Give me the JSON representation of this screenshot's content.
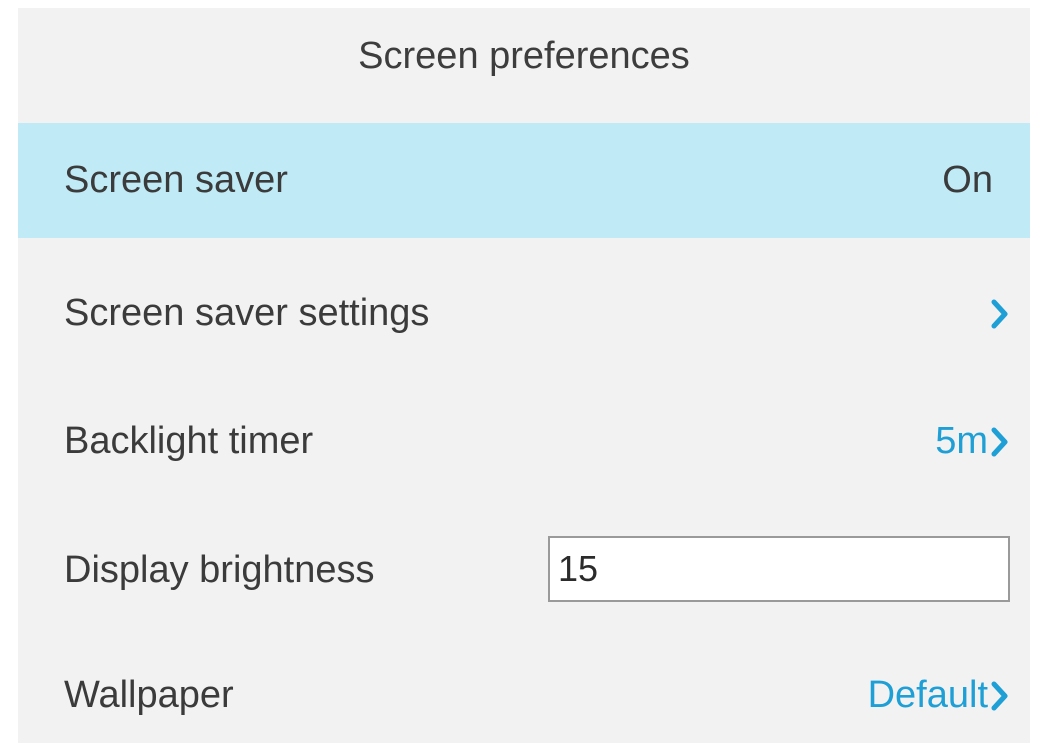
{
  "header": {
    "title": "Screen preferences"
  },
  "rows": {
    "screen_saver": {
      "label": "Screen saver",
      "value": "On"
    },
    "screen_saver_settings": {
      "label": "Screen saver settings"
    },
    "backlight_timer": {
      "label": "Backlight timer",
      "value": "5m"
    },
    "display_brightness": {
      "label": "Display brightness",
      "value": "15"
    },
    "wallpaper": {
      "label": "Wallpaper",
      "value": "Default"
    }
  },
  "icons": {
    "chevron": "chevron-right-icon"
  },
  "colors": {
    "background": "#f2f2f2",
    "selected_row": "#bfeaf6",
    "accent": "#1e9fd6",
    "text": "#3b3b3b"
  }
}
